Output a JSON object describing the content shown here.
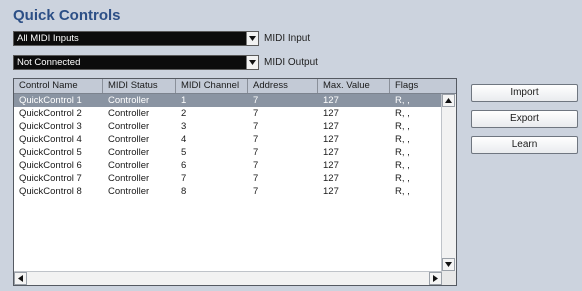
{
  "title": "Quick Controls",
  "midi_input": {
    "value": "All MIDI Inputs",
    "label": "MIDI Input"
  },
  "midi_output": {
    "value": "Not Connected",
    "label": "MIDI Output"
  },
  "table": {
    "columns": [
      "Control Name",
      "MIDI Status",
      "MIDI Channel",
      "Address",
      "Max. Value",
      "Flags"
    ],
    "rows": [
      [
        "QuickControl 1",
        "Controller",
        "1",
        "7",
        "127",
        "R, ,"
      ],
      [
        "QuickControl 2",
        "Controller",
        "2",
        "7",
        "127",
        "R, ,"
      ],
      [
        "QuickControl 3",
        "Controller",
        "3",
        "7",
        "127",
        "R, ,"
      ],
      [
        "QuickControl 4",
        "Controller",
        "4",
        "7",
        "127",
        "R, ,"
      ],
      [
        "QuickControl 5",
        "Controller",
        "5",
        "7",
        "127",
        "R, ,"
      ],
      [
        "QuickControl 6",
        "Controller",
        "6",
        "7",
        "127",
        "R, ,"
      ],
      [
        "QuickControl 7",
        "Controller",
        "7",
        "7",
        "127",
        "R, ,"
      ],
      [
        "QuickControl 8",
        "Controller",
        "8",
        "7",
        "127",
        "R, ,"
      ]
    ],
    "selected_row": 0
  },
  "buttons": {
    "import": "Import",
    "export": "Export",
    "learn": "Learn"
  },
  "colors": {
    "title": "#2c4f86",
    "background": "#ccd3de",
    "selected_row": "#8a94a2"
  }
}
